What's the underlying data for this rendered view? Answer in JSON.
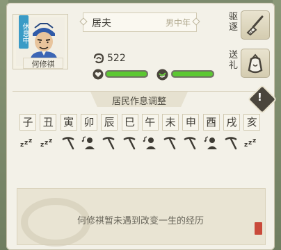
{
  "resident": {
    "status_tag": "休息中",
    "name": "何修祺",
    "occupation": "居夫",
    "gender_age": "男中年",
    "wealth": "522",
    "health_fraction": 1.0,
    "spirit_fraction": 1.0
  },
  "actions": {
    "expel_label": "驱逐",
    "gift_label": "送礼"
  },
  "schedule": {
    "title": "居民作息调整",
    "hours": [
      "子",
      "丑",
      "寅",
      "卯",
      "辰",
      "巳",
      "午",
      "未",
      "申",
      "酉",
      "戌",
      "亥"
    ],
    "activities": [
      "sleep",
      "sleep",
      "work",
      "rest",
      "work",
      "work",
      "rest",
      "work",
      "work",
      "rest",
      "work",
      "sleep"
    ]
  },
  "story": {
    "text": "何修祺暂未遇到改变一生的经历"
  },
  "colors": {
    "bar_fill": "#5cc832",
    "status_tag": "#3a9bc6",
    "seal": "#c94a3b"
  }
}
